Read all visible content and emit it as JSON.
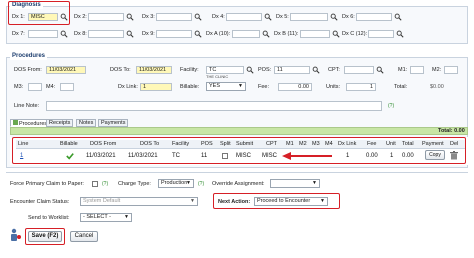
{
  "diagnosis": {
    "legend": "Diagnosis",
    "fields": [
      {
        "label": "Dx 1:",
        "value": "MISC"
      },
      {
        "label": "Dx 2:",
        "value": ""
      },
      {
        "label": "Dx 3:",
        "value": ""
      },
      {
        "label": "Dx 4:",
        "value": ""
      },
      {
        "label": "Dx 5:",
        "value": ""
      },
      {
        "label": "Dx 6:",
        "value": ""
      },
      {
        "label": "Dx 7:",
        "value": ""
      },
      {
        "label": "Dx 8:",
        "value": ""
      },
      {
        "label": "Dx 9:",
        "value": ""
      },
      {
        "label": "Dx A (10):",
        "value": ""
      },
      {
        "label": "Dx B (11):",
        "value": ""
      },
      {
        "label": "Dx C (12):",
        "value": ""
      }
    ]
  },
  "procedures": {
    "legend": "Procedures",
    "dos_from_label": "DOS From:",
    "dos_from_value": "11/03/2021",
    "dos_to_label": "DOS To:",
    "dos_to_value": "11/03/2021",
    "facility_label": "Facility:",
    "facility_value": "TC",
    "facility_sub": "THE CLINIC",
    "pos_label": "POS:",
    "pos_value": "11",
    "cpt_label": "CPT:",
    "cpt_value": "",
    "m1_label": "M1:",
    "m2_label": "M2:",
    "m3_label": "M3:",
    "m4_label": "M4:",
    "dxlink_label": "Dx Link:",
    "dxlink_value": "1",
    "billable_label": "Billable:",
    "billable_value": "YES",
    "fee_label": "Fee:",
    "fee_value": "0.00",
    "units_label": "Units:",
    "units_value": "1",
    "total_label": "Total:",
    "total_value": "$0.00",
    "line_note_label": "Line Note:"
  },
  "tabs": [
    "Procedures",
    "Receipts",
    "Notes",
    "Payments"
  ],
  "total_bar": "Total: 0.00",
  "table": {
    "headers": [
      "Line",
      "Billable",
      "DOS From",
      "DOS To",
      "Facility",
      "POS",
      "Split",
      "Submit",
      "CPT",
      "M1",
      "M2",
      "M3",
      "M4",
      "Dx Link",
      "Fee",
      "Unit",
      "Total",
      "Payment",
      "Del"
    ],
    "rows": [
      {
        "line": "1",
        "dos_from": "11/03/2021",
        "dos_to": "11/03/2021",
        "facility": "TC",
        "pos": "11",
        "submit": "MISC",
        "cpt": "MISC",
        "dxlink": "1",
        "fee": "0.00",
        "unit": "1",
        "total": "0.00",
        "copy": "Copy"
      }
    ]
  },
  "bottom": {
    "force_primary_label": "Force Primary Claim to Paper:",
    "charge_type_label": "Charge Type:",
    "charge_type_value": "Production",
    "override_label": "Override Assignment:",
    "encounter_status_label": "Encounter Claim Status:",
    "encounter_status_value": "System Default",
    "next_action_label": "Next Action:",
    "next_action_value": "Proceed to Encounter",
    "send_label": "Send to Worklist:",
    "send_value": "- SELECT -"
  },
  "buttons": {
    "save": "Save (F2)",
    "cancel": "Cancel"
  },
  "help": "(?)",
  "colors": {
    "accent": "#d61f26",
    "header": "#1c3d6e",
    "yellow_field": "#fff8b8",
    "total_bar": "#c8e6a5"
  }
}
